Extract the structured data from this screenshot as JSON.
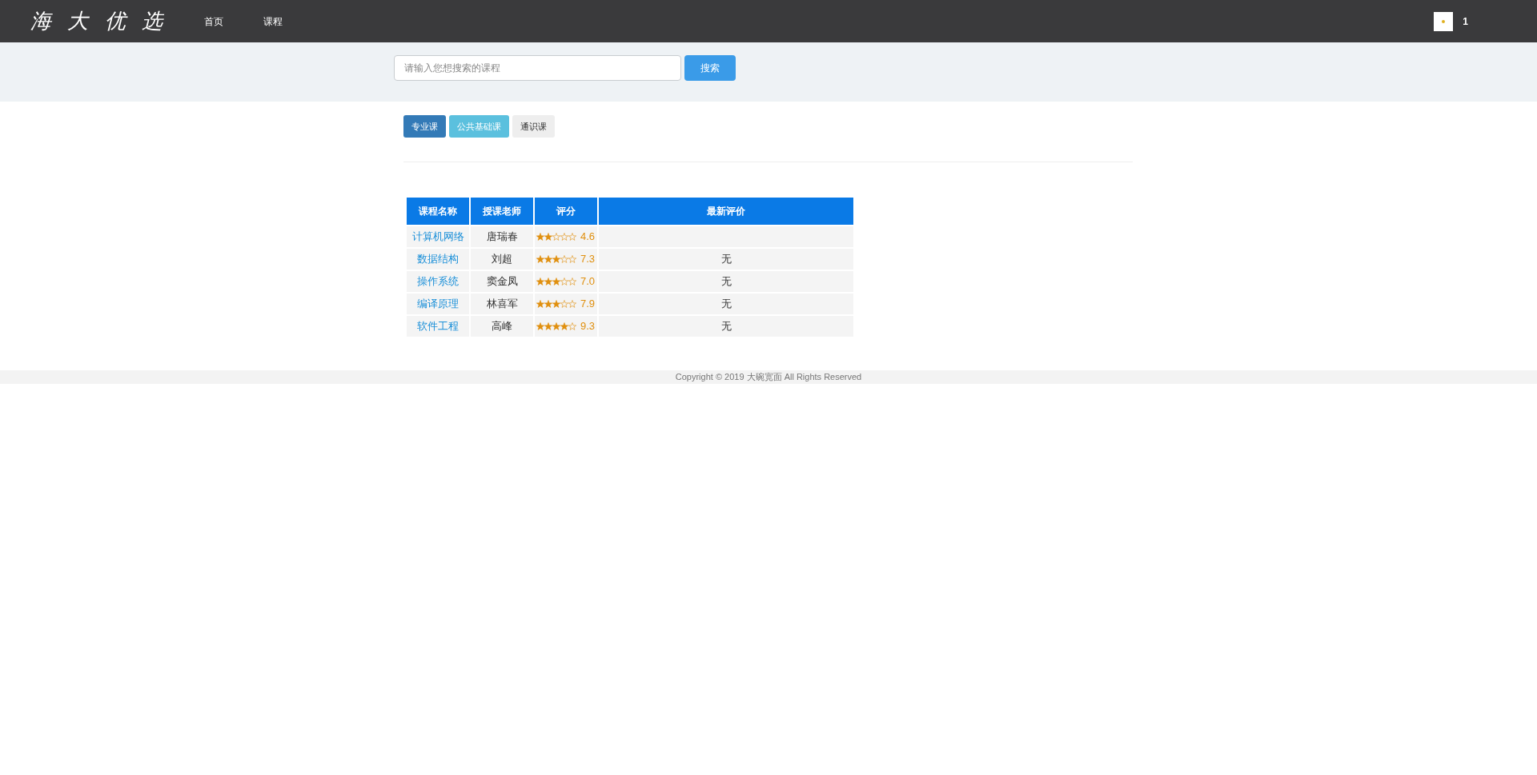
{
  "header": {
    "logo": "海 大 优 选",
    "nav": [
      {
        "label": "首页"
      },
      {
        "label": "课程"
      }
    ],
    "user": "1"
  },
  "search": {
    "placeholder": "请输入您想搜索的课程",
    "button": "搜索"
  },
  "categories": [
    {
      "label": "专业课",
      "color": "#337ab7"
    },
    {
      "label": "公共基础课",
      "color": "#5bc0de"
    },
    {
      "label": "通识课",
      "color": "#eeeeee"
    }
  ],
  "table": {
    "columns": [
      "课程名称",
      "授课老师",
      "评分",
      "最新评价"
    ],
    "rows": [
      {
        "course": "计算机网络",
        "teacher": "唐瑞春",
        "stars": 2,
        "score": "4.6"
      },
      {
        "course": "数据结构",
        "teacher": "刘超",
        "stars": 3,
        "score": "7.3",
        "review": "无"
      },
      {
        "course": "操作系统",
        "teacher": "窦金凤",
        "stars": 3,
        "score": "7.0",
        "review": "无"
      },
      {
        "course": "编译原理",
        "teacher": "林喜军",
        "stars": 3,
        "score": "7.9",
        "review": "无"
      },
      {
        "course": "软件工程",
        "teacher": "高峰",
        "stars": 4,
        "score": "9.3",
        "review": "无"
      }
    ]
  },
  "footer": "Copyright © 2019 大碗宽面 All Rights Reserved"
}
